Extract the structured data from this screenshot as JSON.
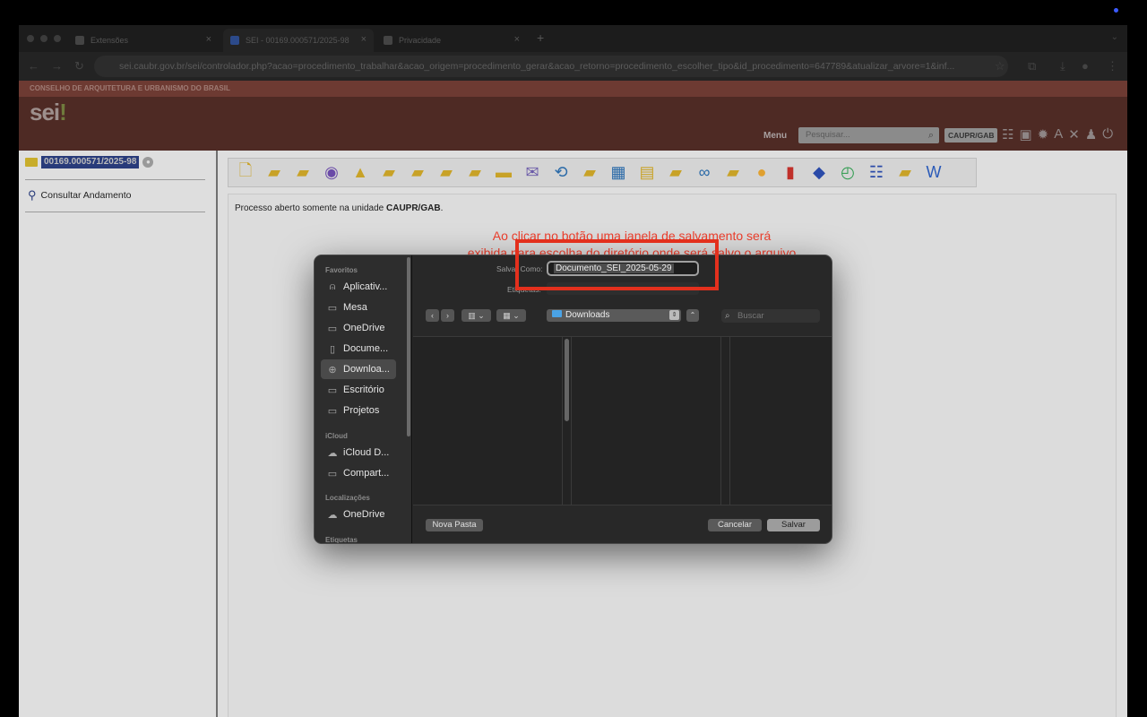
{
  "browser": {
    "tabs": [
      {
        "label": "Extensões",
        "icon": "puzzle-icon"
      },
      {
        "label": "SEI - 00169.000571/2025-98",
        "icon": "sei-favicon"
      },
      {
        "label": "Privacidade",
        "icon": "privacy-icon"
      }
    ],
    "new_tab": "+",
    "url_prefix": "sei.caubr.gov.br/",
    "url": "sei/controlador.php?acao=procedimento_trabalhar&acao_origem=procedimento_gerar&acao_retorno=procedimento_escolher_tipo&id_procedimento=647789&atualizar_arvore=1&inf..."
  },
  "sei": {
    "org_name": "CONSELHO DE ARQUITETURA E URBANISMO DO BRASIL",
    "logo": "sei",
    "logo_bang": "!",
    "menu_label": "Menu",
    "search_placeholder": "Pesquisar...",
    "unit": "CAUPR/GAB"
  },
  "sidebar": {
    "process_number": "00169.000571/2025-98",
    "consult_label": "Consultar Andamento"
  },
  "content": {
    "message_prefix": "Processo aberto somente na unidade ",
    "message_unit": "CAUPR/GAB",
    "message_suffix": "."
  },
  "annotation": {
    "line1": "Ao clicar no botão uma janela de salvamento será",
    "line2": "exibida para escolha do diretório onde será salvo o arquivo",
    "color": "#ef3e2c"
  },
  "dialog": {
    "sections": {
      "favorites": "Favoritos",
      "icloud": "iCloud",
      "locations": "Localizações",
      "tags": "Etiquetas"
    },
    "favorites": [
      {
        "label": "Aplicativ...",
        "icon": "apps-icon"
      },
      {
        "label": "Mesa",
        "icon": "desktop-icon"
      },
      {
        "label": "OneDrive",
        "icon": "folder-icon"
      },
      {
        "label": "Docume...",
        "icon": "document-icon"
      },
      {
        "label": "Downloa...",
        "icon": "download-icon"
      },
      {
        "label": "Escritório",
        "icon": "folder-icon"
      },
      {
        "label": "Projetos",
        "icon": "folder-icon"
      }
    ],
    "icloud": [
      {
        "label": "iCloud D...",
        "icon": "cloud-icon"
      },
      {
        "label": "Compart...",
        "icon": "shared-folder-icon"
      }
    ],
    "locations": [
      {
        "label": "OneDrive",
        "icon": "cloud-filled-icon"
      }
    ],
    "save_as_label": "Salvar Como:",
    "save_as_value": "Documento_SEI_2025-05-29",
    "tags_label": "Etiquetas:",
    "location": "Downloads",
    "search_placeholder": "Buscar",
    "new_folder": "Nova Pasta",
    "cancel": "Cancelar",
    "save": "Salvar"
  }
}
